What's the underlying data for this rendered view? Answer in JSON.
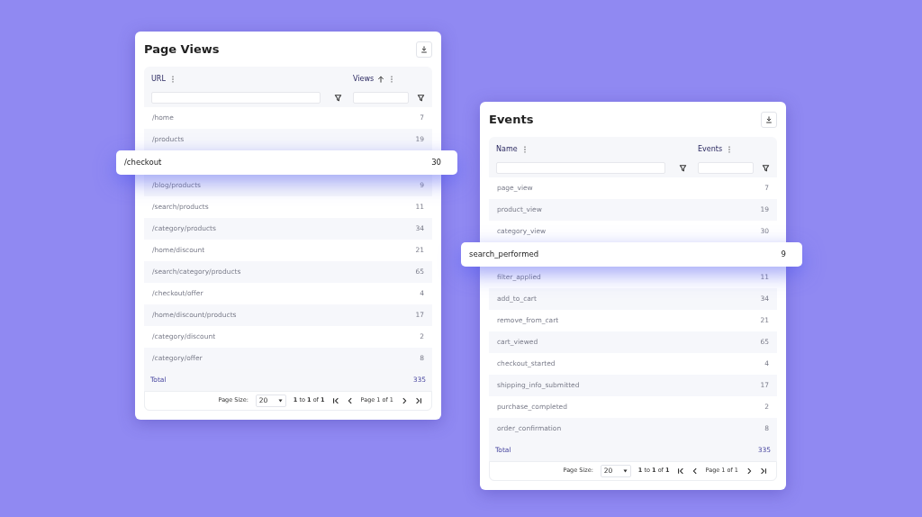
{
  "panels": [
    {
      "title": "Page Views",
      "columns": [
        {
          "label": "URL",
          "sorted_ascending": false
        },
        {
          "label": "Views",
          "sorted_ascending": true
        }
      ],
      "rows": [
        {
          "cells": [
            "/home",
            "7"
          ],
          "highlighted": false
        },
        {
          "cells": [
            "/products",
            "19"
          ],
          "highlighted": false
        },
        {
          "cells": [
            "/checkout",
            "30"
          ],
          "highlighted": true
        },
        {
          "cells": [
            "/blog/products",
            "9"
          ],
          "highlighted": false
        },
        {
          "cells": [
            "/search/products",
            "11"
          ],
          "highlighted": false
        },
        {
          "cells": [
            "/category/products",
            "34"
          ],
          "highlighted": false
        },
        {
          "cells": [
            "/home/discount",
            "21"
          ],
          "highlighted": false
        },
        {
          "cells": [
            "/search/category/products",
            "65"
          ],
          "highlighted": false
        },
        {
          "cells": [
            "/checkout/offer",
            "4"
          ],
          "highlighted": false
        },
        {
          "cells": [
            "/home/discount/products",
            "17"
          ],
          "highlighted": false
        },
        {
          "cells": [
            "/category/discount",
            "2"
          ],
          "highlighted": false
        },
        {
          "cells": [
            "/category/offer",
            "8"
          ],
          "highlighted": false
        }
      ],
      "total": {
        "label": "Total",
        "value": "335"
      },
      "pager": {
        "page_size_label": "Page Size:",
        "page_size": "20",
        "range": "**1** to **1** of **1**",
        "page": "Page 1 of 1"
      }
    },
    {
      "title": "Events",
      "columns": [
        {
          "label": "Name",
          "sorted_ascending": false
        },
        {
          "label": "Events",
          "sorted_ascending": false
        }
      ],
      "rows": [
        {
          "cells": [
            "page_view",
            "7"
          ],
          "highlighted": false
        },
        {
          "cells": [
            "product_view",
            "19"
          ],
          "highlighted": false
        },
        {
          "cells": [
            "category_view",
            "30"
          ],
          "highlighted": false
        },
        {
          "cells": [
            "search_performed",
            "9"
          ],
          "highlighted": true
        },
        {
          "cells": [
            "filter_applied",
            "11"
          ],
          "highlighted": false
        },
        {
          "cells": [
            "add_to_cart",
            "34"
          ],
          "highlighted": false
        },
        {
          "cells": [
            "remove_from_cart",
            "21"
          ],
          "highlighted": false
        },
        {
          "cells": [
            "cart_viewed",
            "65"
          ],
          "highlighted": false
        },
        {
          "cells": [
            "checkout_started",
            "4"
          ],
          "highlighted": false
        },
        {
          "cells": [
            "shipping_info_submitted",
            "17"
          ],
          "highlighted": false
        },
        {
          "cells": [
            "purchase_completed",
            "2"
          ],
          "highlighted": false
        },
        {
          "cells": [
            "order_confirmation",
            "8"
          ],
          "highlighted": false
        }
      ],
      "total": {
        "label": "Total",
        "value": "335"
      },
      "pager": {
        "page_size_label": "Page Size:",
        "page_size": "20",
        "range": "**1** to **1** of **1**",
        "page": "Page 1 of 1"
      }
    }
  ]
}
